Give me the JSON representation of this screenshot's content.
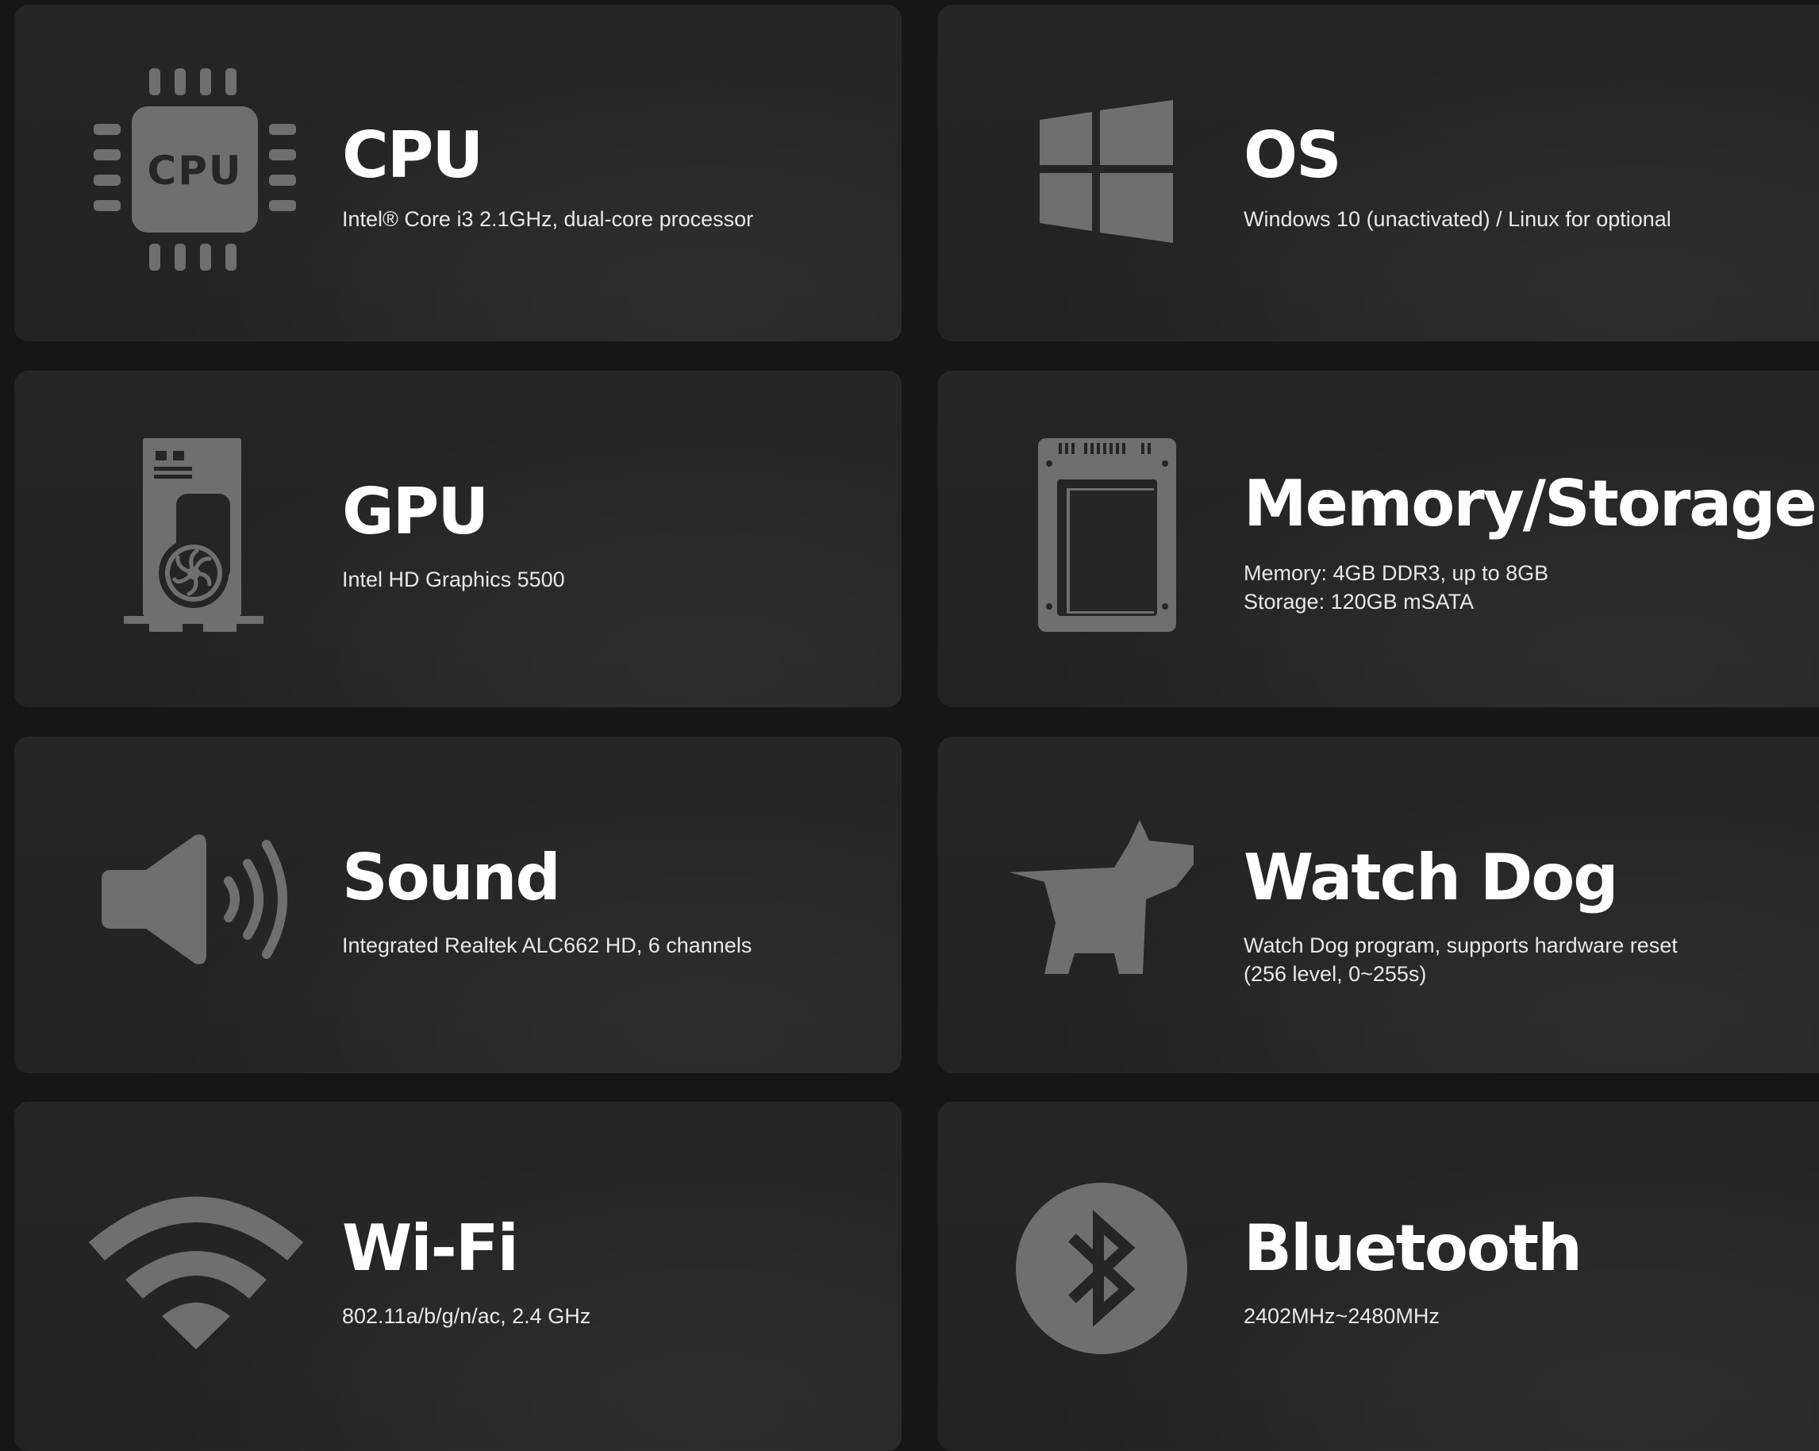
{
  "colors": {
    "background": "#161616",
    "card": "#252525",
    "icon": "#6f6f6f",
    "title": "#ffffff",
    "text": "#e8e8e8"
  },
  "specs": [
    {
      "key": "cpu",
      "icon": "cpu-chip-icon",
      "icon_text": "CPU",
      "title": "CPU",
      "lines": [
        "Intel® Core i3 2.1GHz, dual-core processor"
      ]
    },
    {
      "key": "os",
      "icon": "windows-logo-icon",
      "title": "OS",
      "lines": [
        "Windows 10 (unactivated) / Linux for optional"
      ]
    },
    {
      "key": "gpu",
      "icon": "graphics-card-icon",
      "title": "GPU",
      "lines": [
        "Intel HD Graphics 5500"
      ]
    },
    {
      "key": "memory-storage",
      "icon": "ssd-drive-icon",
      "title": "Memory/Storage",
      "lines": [
        "Memory: 4GB DDR3, up to 8GB",
        "Storage: 120GB mSATA"
      ]
    },
    {
      "key": "sound",
      "icon": "speaker-icon",
      "title": "Sound",
      "lines": [
        "Integrated Realtek ALC662 HD, 6 channels"
      ]
    },
    {
      "key": "watch-dog",
      "icon": "dog-icon",
      "title": "Watch Dog",
      "lines": [
        "Watch Dog program, supports hardware reset",
        "(256 level, 0~255s)"
      ]
    },
    {
      "key": "wifi",
      "icon": "wifi-icon",
      "title": "Wi-Fi",
      "lines": [
        "802.11a/b/g/n/ac, 2.4 GHz"
      ]
    },
    {
      "key": "bluetooth",
      "icon": "bluetooth-icon",
      "title": "Bluetooth",
      "lines": [
        "2402MHz~2480MHz"
      ]
    }
  ]
}
